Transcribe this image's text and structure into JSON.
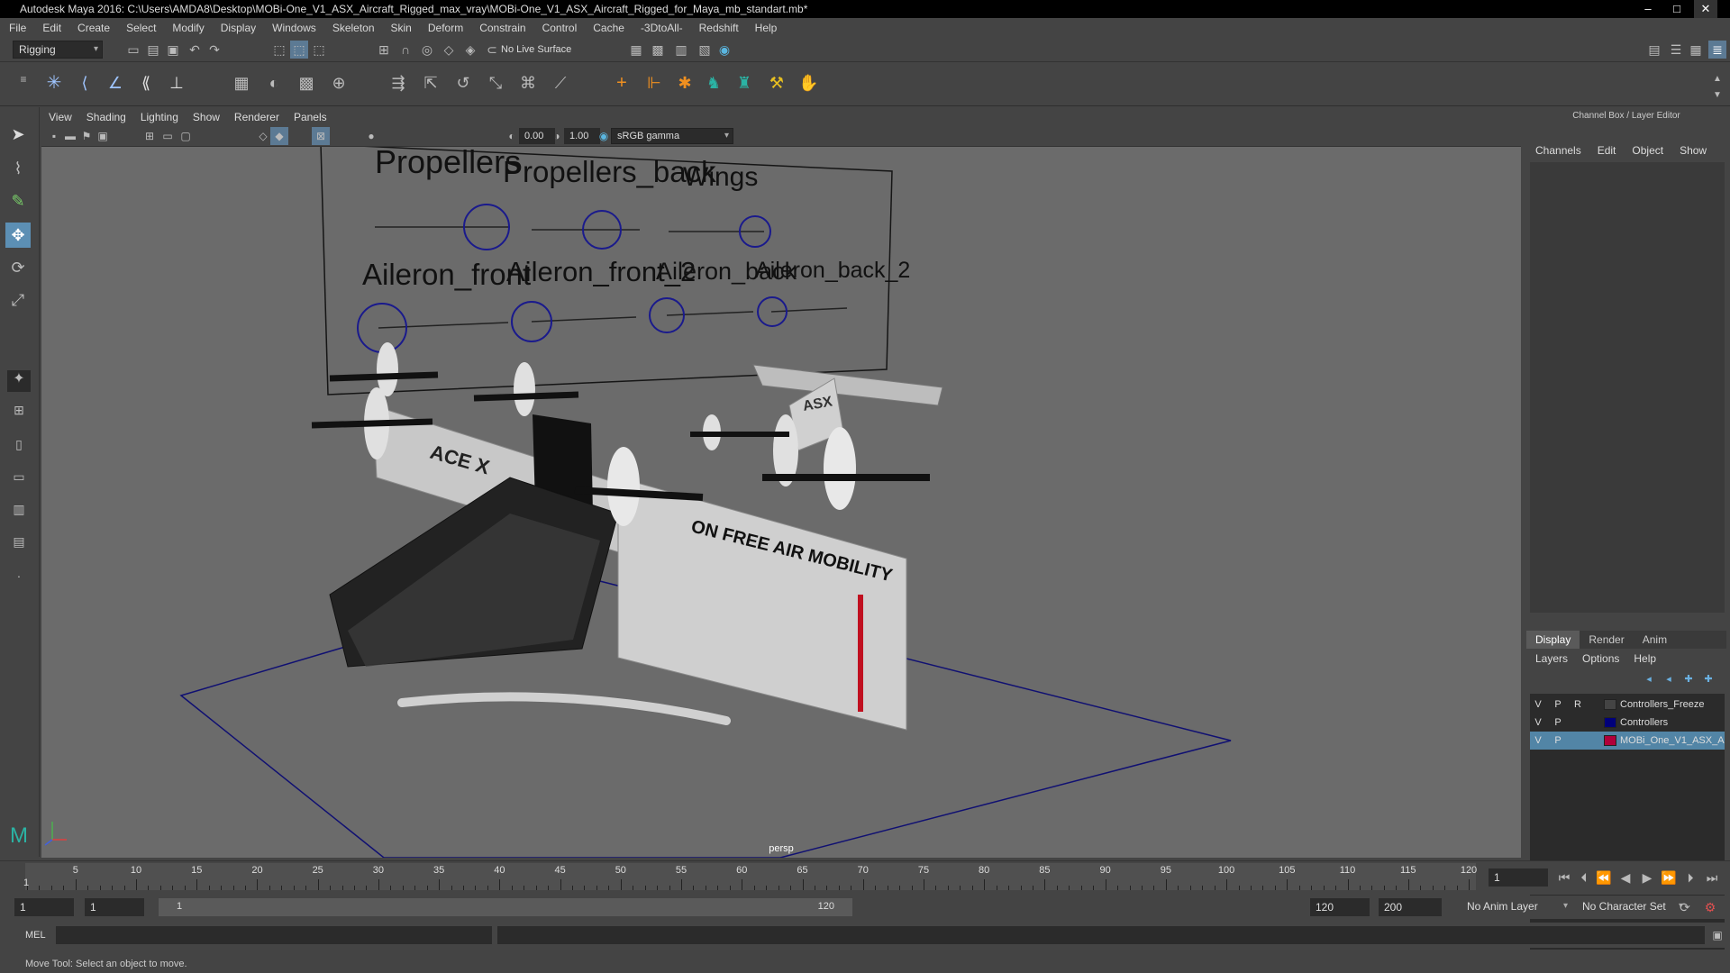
{
  "window": {
    "title": "Autodesk Maya 2016: C:\\Users\\AMDA8\\Desktop\\MOBi-One_V1_ASX_Aircraft_Rigged_max_vray\\MOBi-One_V1_ASX_Aircraft_Rigged_for_Maya_mb_standart.mb*",
    "minimize": "–",
    "maximize": "□",
    "close": "✕"
  },
  "menu": [
    "File",
    "Edit",
    "Create",
    "Select",
    "Modify",
    "Display",
    "Windows",
    "Skeleton",
    "Skin",
    "Deform",
    "Constrain",
    "Control",
    "Cache",
    "-3DtoAll-",
    "Redshift",
    "Help"
  ],
  "status": {
    "menuset": "Rigging",
    "live_surface": "No Live Surface"
  },
  "viewport": {
    "menu": [
      "View",
      "Shading",
      "Lighting",
      "Show",
      "Renderer",
      "Panels"
    ],
    "exposure": "0.00",
    "gamma": "1.00",
    "color_space": "sRGB gamma",
    "camera": "persp"
  },
  "control_panel": {
    "labels": [
      "Propellers",
      "Propellers_back",
      "Wings",
      "Aileron_front",
      "Aileron_front_2",
      "Aileron_back",
      "Aileron_back_2"
    ]
  },
  "aircraft_text": {
    "side_slogan": "ON FREE AIR MOBILITY",
    "brand_front": "ACE X",
    "tail_logo": "ASX"
  },
  "right_panel": {
    "header": "Channel Box / Layer Editor",
    "channel_tabs": [
      "Channels",
      "Edit",
      "Object",
      "Show"
    ],
    "layer_tabs": [
      "Display",
      "Render",
      "Anim"
    ],
    "layer_tab_active": "Display",
    "layer_menu": [
      "Layers",
      "Options",
      "Help"
    ],
    "layers": [
      {
        "v": "V",
        "p": "P",
        "r": "R",
        "name": "Controllers_Freeze",
        "color": "#444444",
        "selected": false
      },
      {
        "v": "V",
        "p": "P",
        "r": "",
        "name": "Controllers",
        "color": "#00007a",
        "selected": false
      },
      {
        "v": "V",
        "p": "P",
        "r": "",
        "name": "MOBi_One_V1_ASX_Aircraft",
        "color": "#b0003a",
        "selected": true
      }
    ]
  },
  "timeline": {
    "ticks": [
      "5",
      "10",
      "15",
      "20",
      "25",
      "30",
      "35",
      "40",
      "45",
      "50",
      "55",
      "60",
      "65",
      "70",
      "75",
      "80",
      "85",
      "90",
      "95",
      "100",
      "105",
      "110",
      "115",
      "120"
    ],
    "current_marker": "1",
    "current_frame": "1"
  },
  "range": {
    "start": "1",
    "playback_start": "1",
    "slider_start": "1",
    "slider_end": "120",
    "playback_end": "120",
    "end": "200",
    "anim_layer": "No Anim Layer",
    "character_set": "No Character Set"
  },
  "command_line": {
    "label": "MEL"
  },
  "help_line": "Move Tool: Select an object to move."
}
